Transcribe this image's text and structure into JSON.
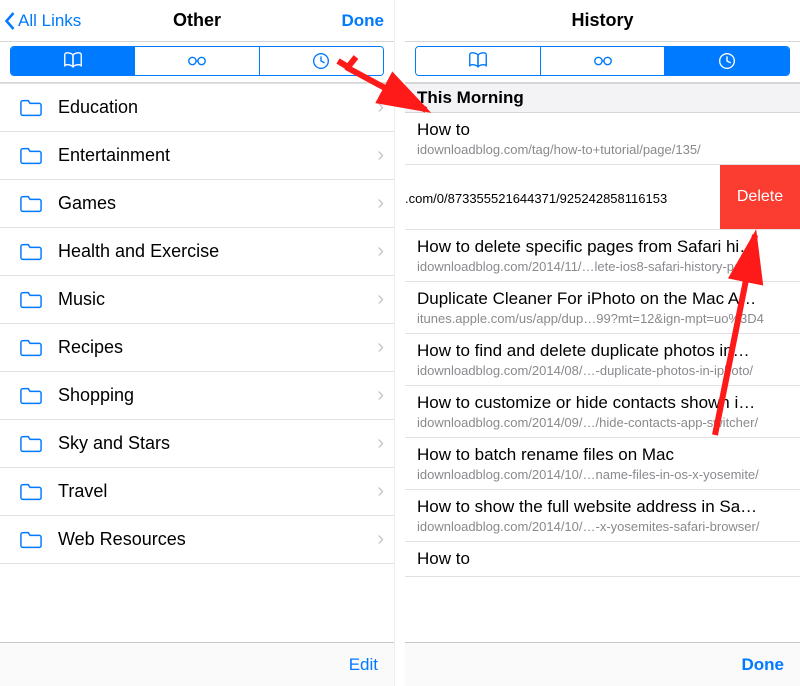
{
  "colors": {
    "accent": "#007aff",
    "delete": "#fb3c30"
  },
  "left": {
    "back_label": "All Links",
    "title": "Other",
    "done_label": "Done",
    "segments": [
      "bookmarks-icon",
      "reading-list-icon",
      "history-icon"
    ],
    "active_segment": 0,
    "folders": [
      {
        "label": "Education"
      },
      {
        "label": "Entertainment"
      },
      {
        "label": "Games"
      },
      {
        "label": "Health and Exercise"
      },
      {
        "label": "Music"
      },
      {
        "label": "Recipes"
      },
      {
        "label": "Shopping"
      },
      {
        "label": "Sky and Stars"
      },
      {
        "label": "Travel"
      },
      {
        "label": "Web Resources"
      }
    ],
    "toolbar_right": "Edit"
  },
  "right": {
    "title": "History",
    "segments": [
      "bookmarks-icon",
      "reading-list-icon",
      "history-icon"
    ],
    "active_segment": 2,
    "section_header": "This Morning",
    "delete_label": "Delete",
    "items": [
      {
        "title": "How to",
        "url": "idownloadblog.com/tag/how-to+tutorial/page/135/"
      },
      {
        "title": "",
        "url": ".com/0/873355521644371/925242858116153"
      },
      {
        "title": "How to delete specific pages from Safari hi…",
        "url": "idownloadblog.com/2014/11/…lete-ios8-safari-history-page/"
      },
      {
        "title": "Duplicate Cleaner For iPhoto on the Mac A…",
        "url": "itunes.apple.com/us/app/dup…99?mt=12&ign-mpt=uo%3D4"
      },
      {
        "title": "How to find and delete duplicate photos in…",
        "url": "idownloadblog.com/2014/08/…-duplicate-photos-in-iphoto/"
      },
      {
        "title": "How to customize or hide contacts shown i…",
        "url": "idownloadblog.com/2014/09/…/hide-contacts-app-switcher/"
      },
      {
        "title": "How to batch rename files on Mac",
        "url": "idownloadblog.com/2014/10/…name-files-in-os-x-yosemite/"
      },
      {
        "title": "How to show the full website address in Sa…",
        "url": "idownloadblog.com/2014/10/…-x-yosemites-safari-browser/"
      },
      {
        "title": "How to",
        "url": ""
      }
    ],
    "toolbar_right": "Done"
  }
}
